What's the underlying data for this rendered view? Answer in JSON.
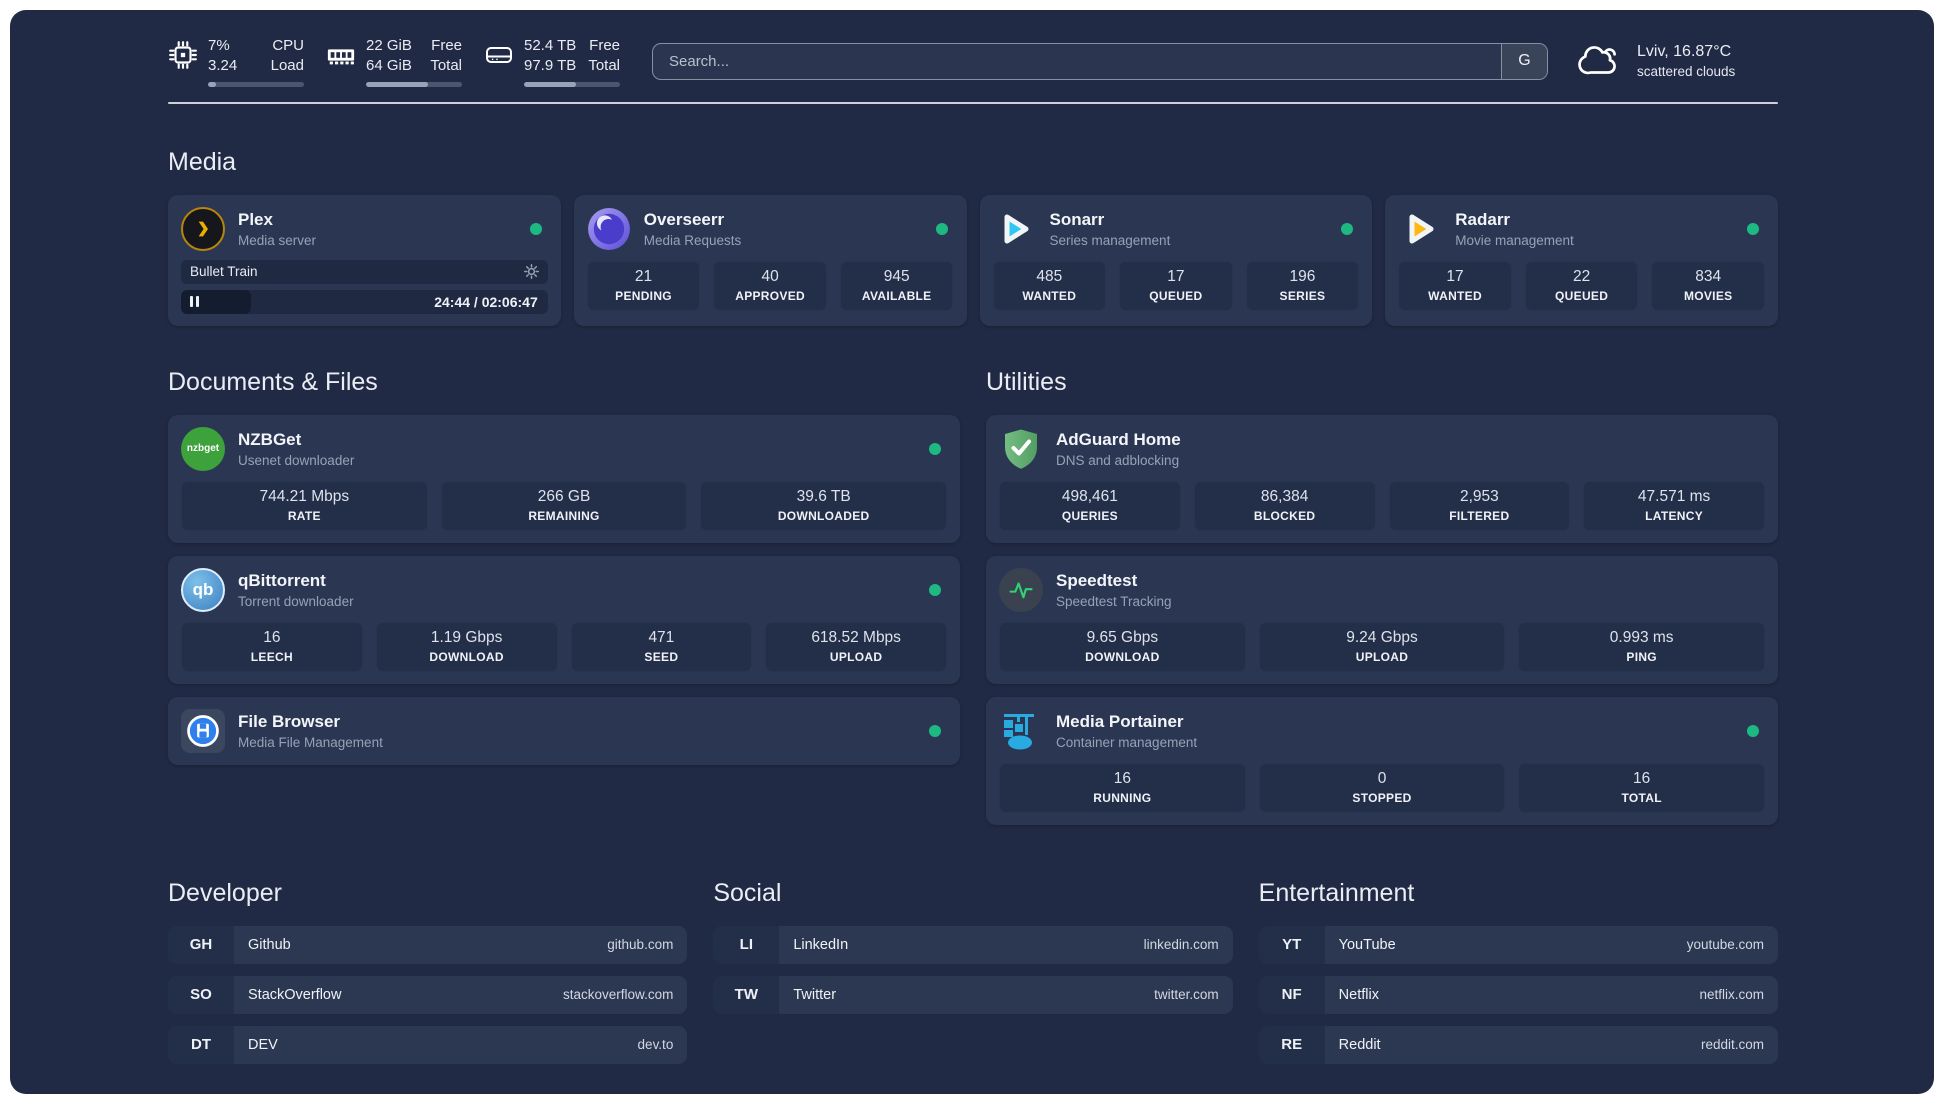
{
  "header": {
    "cpu": {
      "line1": "7%",
      "line2": "3.24",
      "label1": "CPU",
      "label2": "Load",
      "progress_pct": 8
    },
    "memory": {
      "line1": "22 GiB",
      "line2": "64 GiB",
      "label1": "Free",
      "label2": "Total",
      "progress_pct": 65
    },
    "disk": {
      "line1": "52.4 TB",
      "line2": "97.9 TB",
      "label1": "Free",
      "label2": "Total",
      "progress_pct": 54
    },
    "search": {
      "placeholder": "Search...",
      "engine_button": "G"
    },
    "weather": {
      "location": "Lviv, 16.87°C",
      "condition": "scattered clouds"
    }
  },
  "sections": {
    "media": "Media",
    "documents": "Documents & Files",
    "utilities": "Utilities"
  },
  "apps": {
    "plex": {
      "name": "Plex",
      "desc": "Media server",
      "status": "online",
      "player": {
        "title": "Bullet Train",
        "time": "24:44 / 02:06:47",
        "progress_pct": 19
      }
    },
    "overseerr": {
      "name": "Overseerr",
      "desc": "Media Requests",
      "status": "online",
      "stats": [
        {
          "value": "21",
          "label": "PENDING"
        },
        {
          "value": "40",
          "label": "APPROVED"
        },
        {
          "value": "945",
          "label": "AVAILABLE"
        }
      ]
    },
    "sonarr": {
      "name": "Sonarr",
      "desc": "Series management",
      "status": "online",
      "stats": [
        {
          "value": "485",
          "label": "WANTED"
        },
        {
          "value": "17",
          "label": "QUEUED"
        },
        {
          "value": "196",
          "label": "SERIES"
        }
      ]
    },
    "radarr": {
      "name": "Radarr",
      "desc": "Movie management",
      "status": "online",
      "stats": [
        {
          "value": "17",
          "label": "WANTED"
        },
        {
          "value": "22",
          "label": "QUEUED"
        },
        {
          "value": "834",
          "label": "MOVIES"
        }
      ]
    },
    "nzbget": {
      "name": "NZBGet",
      "desc": "Usenet downloader",
      "status": "online",
      "icon_text": "nzbget",
      "stats": [
        {
          "value": "744.21 Mbps",
          "label": "RATE"
        },
        {
          "value": "266 GB",
          "label": "REMAINING"
        },
        {
          "value": "39.6 TB",
          "label": "DOWNLOADED"
        }
      ]
    },
    "qbittorrent": {
      "name": "qBittorrent",
      "desc": "Torrent downloader",
      "status": "online",
      "icon_text": "qb",
      "stats": [
        {
          "value": "16",
          "label": "LEECH"
        },
        {
          "value": "1.19 Gbps",
          "label": "DOWNLOAD"
        },
        {
          "value": "471",
          "label": "SEED"
        },
        {
          "value": "618.52 Mbps",
          "label": "UPLOAD"
        }
      ]
    },
    "filebrowser": {
      "name": "File Browser",
      "desc": "Media File Management",
      "status": "online"
    },
    "adguard": {
      "name": "AdGuard Home",
      "desc": "DNS and adblocking",
      "stats": [
        {
          "value": "498,461",
          "label": "QUERIES"
        },
        {
          "value": "86,384",
          "label": "BLOCKED"
        },
        {
          "value": "2,953",
          "label": "FILTERED"
        },
        {
          "value": "47.571 ms",
          "label": "LATENCY"
        }
      ]
    },
    "speedtest": {
      "name": "Speedtest",
      "desc": "Speedtest Tracking",
      "stats": [
        {
          "value": "9.65 Gbps",
          "label": "DOWNLOAD"
        },
        {
          "value": "9.24 Gbps",
          "label": "UPLOAD"
        },
        {
          "value": "0.993 ms",
          "label": "PING"
        }
      ]
    },
    "portainer": {
      "name": "Media Portainer",
      "desc": "Container management",
      "status": "online",
      "stats": [
        {
          "value": "16",
          "label": "RUNNING"
        },
        {
          "value": "0",
          "label": "STOPPED"
        },
        {
          "value": "16",
          "label": "TOTAL"
        }
      ]
    }
  },
  "bookmarks": {
    "developer": {
      "heading": "Developer",
      "items": [
        {
          "abbr": "GH",
          "name": "Github",
          "url": "github.com"
        },
        {
          "abbr": "SO",
          "name": "StackOverflow",
          "url": "stackoverflow.com"
        },
        {
          "abbr": "DT",
          "name": "DEV",
          "url": "dev.to"
        }
      ]
    },
    "social": {
      "heading": "Social",
      "items": [
        {
          "abbr": "LI",
          "name": "LinkedIn",
          "url": "linkedin.com"
        },
        {
          "abbr": "TW",
          "name": "Twitter",
          "url": "twitter.com"
        }
      ]
    },
    "entertainment": {
      "heading": "Entertainment",
      "items": [
        {
          "abbr": "YT",
          "name": "YouTube",
          "url": "youtube.com"
        },
        {
          "abbr": "NF",
          "name": "Netflix",
          "url": "netflix.com"
        },
        {
          "abbr": "RE",
          "name": "Reddit",
          "url": "reddit.com"
        }
      ]
    }
  },
  "colors": {
    "status_online": "#1db980",
    "accent_green": "#2ed573"
  }
}
